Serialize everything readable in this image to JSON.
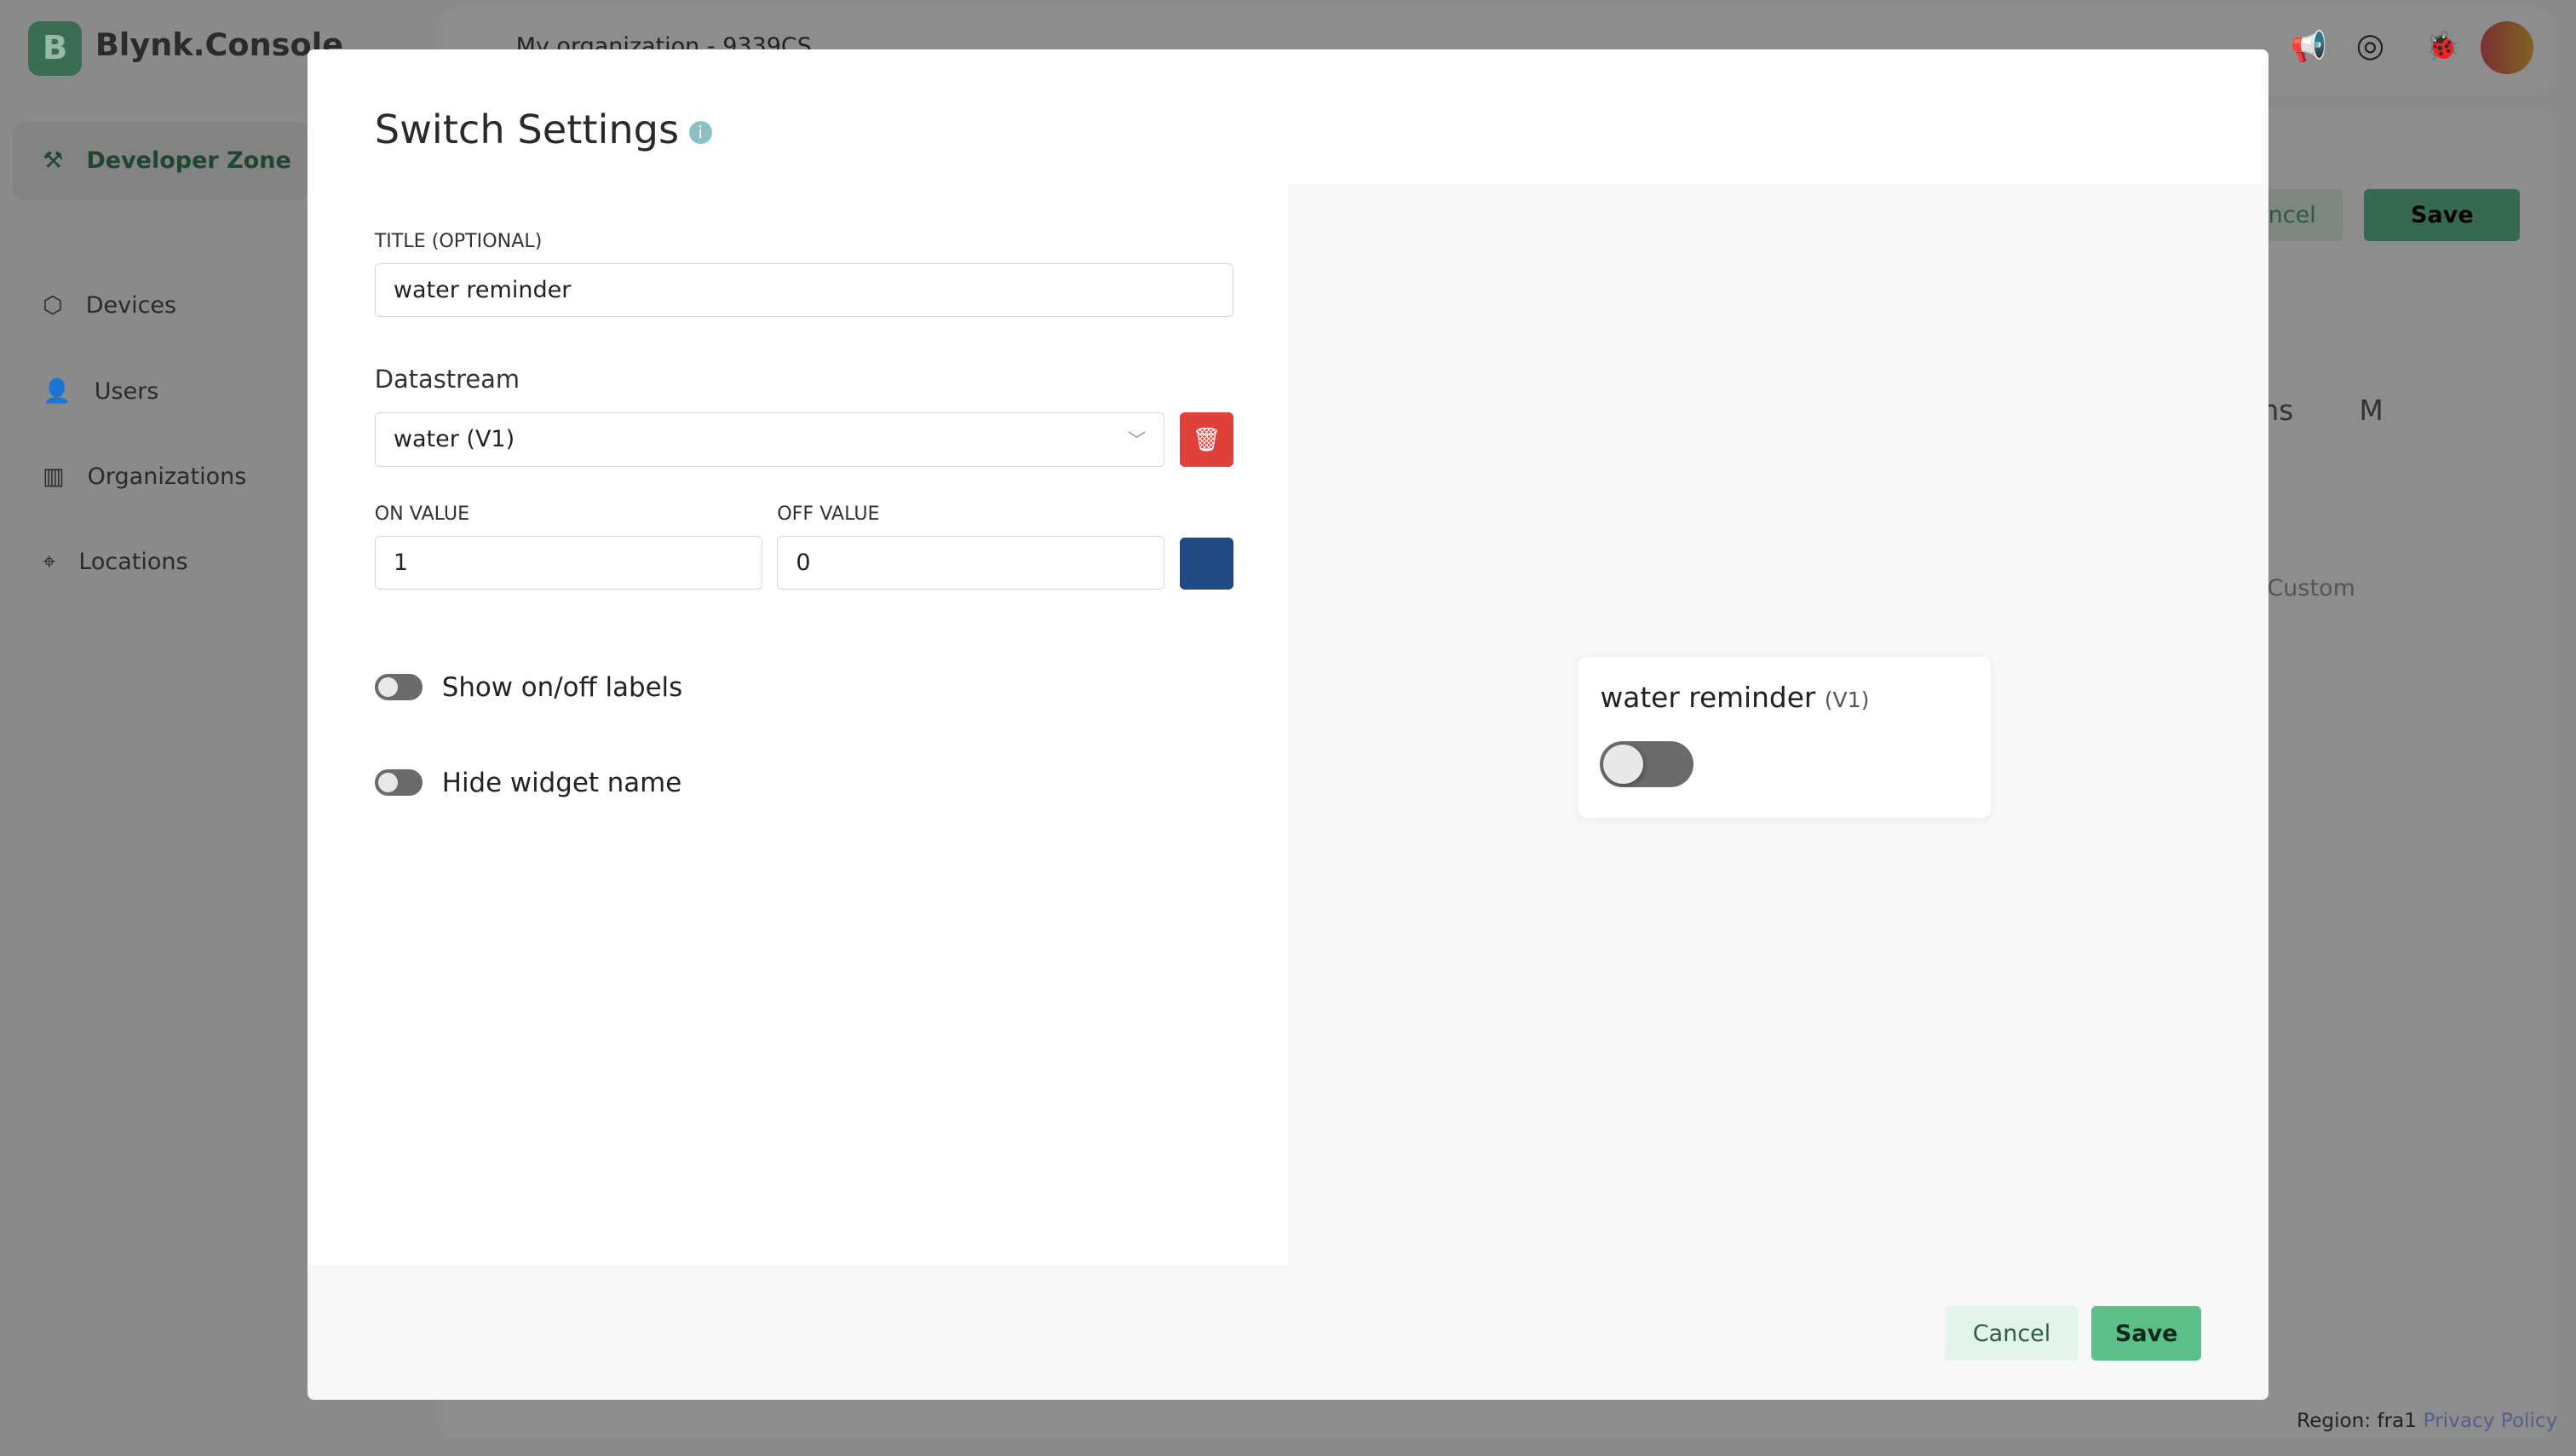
{
  "app": {
    "logo_letter": "B",
    "brand": "Blynk.Console"
  },
  "sidebar": {
    "items": [
      {
        "label": "Developer Zone",
        "icon": "tools-icon",
        "active": true
      },
      {
        "label": "Devices",
        "icon": "cube-icon"
      },
      {
        "label": "Users",
        "icon": "users-icon"
      },
      {
        "label": "Organizations",
        "icon": "building-icon"
      },
      {
        "label": "Locations",
        "icon": "pin-icon"
      }
    ]
  },
  "topbar": {
    "org": "My organization - 9339CS"
  },
  "background": {
    "cancel": "Cancel",
    "save": "Save",
    "tab_partial": "ons",
    "tab_m": "M",
    "custom": "Custom",
    "region": "Region: fra1",
    "privacy": "Privacy Policy"
  },
  "modal": {
    "title": "Switch Settings",
    "title_field": {
      "label": "TITLE (OPTIONAL)",
      "value": "water reminder"
    },
    "datastream": {
      "label": "Datastream",
      "value": "water (V1)"
    },
    "on_value": {
      "label": "ON VALUE",
      "value": "1"
    },
    "off_value": {
      "label": "OFF VALUE",
      "value": "0"
    },
    "color": "#1f4a86",
    "show_labels": {
      "label": "Show on/off labels",
      "on": false
    },
    "hide_name": {
      "label": "Hide widget name",
      "on": false
    },
    "preview": {
      "title": "water reminder",
      "pin": "(V1)",
      "state": "off"
    },
    "cancel": "Cancel",
    "save": "Save"
  },
  "colors": {
    "accent": "#5cbf8a",
    "delete": "#e0403a"
  }
}
